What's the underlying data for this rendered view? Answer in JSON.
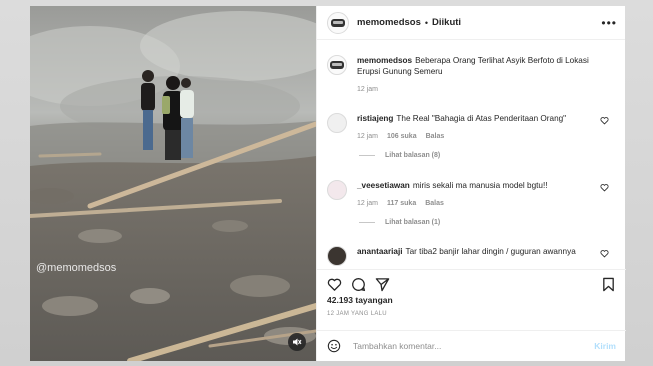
{
  "post": {
    "username": "memomedsos",
    "follow_status": "Diikuti",
    "separator": "•",
    "watermark": "@memomedsos"
  },
  "caption": {
    "username": "memomedsos",
    "text": "Beberapa Orang Terlihat Asyik Berfoto di Lokasi Erupsi Gunung Semeru",
    "time": "12 jam"
  },
  "comments": [
    {
      "username": "ristiajeng",
      "text": "The Real \"Bahagia di Atas Penderitaan Orang\"",
      "time": "12 jam",
      "likes": "106 suka",
      "reply": "Balas",
      "view_replies": "Lihat balasan (8)"
    },
    {
      "username": "_veesetiawan",
      "text": "miris sekali ma manusia model bgtu!!",
      "time": "12 jam",
      "likes": "117 suka",
      "reply": "Balas",
      "view_replies": "Lihat balasan (1)"
    },
    {
      "username": "anantaariaji",
      "text": "Tar tiba2 banjir lahar dingin / guguran awannya"
    }
  ],
  "stats": {
    "views": "42.193 tayangan",
    "posted": "12 JAM YANG LALU"
  },
  "compose": {
    "placeholder": "Tambahkan komentar...",
    "send": "Kirim"
  },
  "icons": {
    "like": "heart-icon",
    "comment": "comment-icon",
    "share": "paper-plane-icon",
    "save": "bookmark-icon",
    "emoji": "smiley-icon",
    "mute": "speaker-muted-icon"
  },
  "colors": {
    "text": "#262626",
    "muted": "#8e8e8e",
    "link_disabled": "#b2dffc",
    "border": "#efefef"
  }
}
